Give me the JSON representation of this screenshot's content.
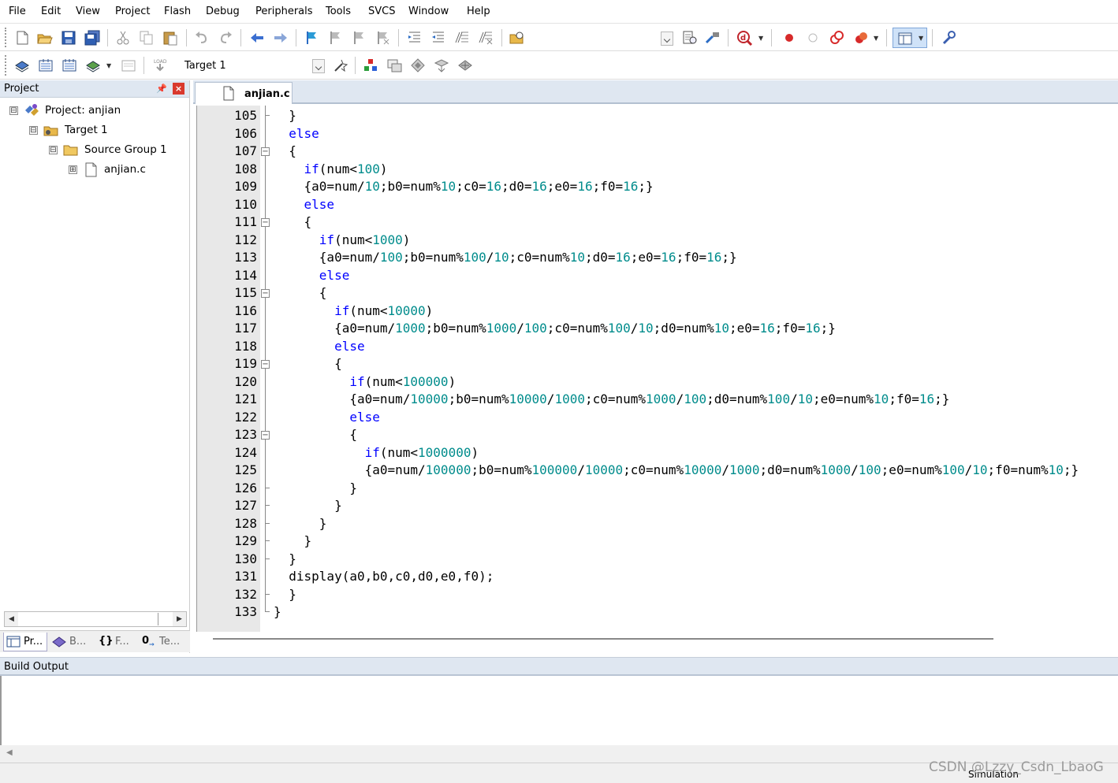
{
  "menu": [
    "File",
    "Edit",
    "View",
    "Project",
    "Flash",
    "Debug",
    "Peripherals",
    "Tools",
    "SVCS",
    "Window",
    "Help"
  ],
  "toolbar": {
    "target": "Target 1"
  },
  "project_panel": {
    "title": "Project",
    "tree": [
      {
        "label": "Project: anjian",
        "depth": 0,
        "expander": "⊟"
      },
      {
        "label": "Target 1",
        "depth": 1,
        "expander": "⊟"
      },
      {
        "label": "Source Group 1",
        "depth": 2,
        "expander": "⊟"
      },
      {
        "label": "anjian.c",
        "depth": 3,
        "expander": "⊞"
      }
    ],
    "tabs": [
      "Pr...",
      "B...",
      "F...",
      "Te..."
    ]
  },
  "editor": {
    "file_tab": "anjian.c",
    "lines": [
      {
        "n": "105",
        "text": "  }"
      },
      {
        "n": "106",
        "text": "  else"
      },
      {
        "n": "107",
        "text": "  {"
      },
      {
        "n": "108",
        "text": "    if(num<100)"
      },
      {
        "n": "109",
        "text": "    {a0=num/10;b0=num%10;c0=16;d0=16;e0=16;f0=16;}"
      },
      {
        "n": "110",
        "text": "    else"
      },
      {
        "n": "111",
        "text": "    {"
      },
      {
        "n": "112",
        "text": "      if(num<1000)"
      },
      {
        "n": "113",
        "text": "      {a0=num/100;b0=num%100/10;c0=num%10;d0=16;e0=16;f0=16;}"
      },
      {
        "n": "114",
        "text": "      else"
      },
      {
        "n": "115",
        "text": "      {"
      },
      {
        "n": "116",
        "text": "        if(num<10000)"
      },
      {
        "n": "117",
        "text": "        {a0=num/1000;b0=num%1000/100;c0=num%100/10;d0=num%10;e0=16;f0=16;}"
      },
      {
        "n": "118",
        "text": "        else"
      },
      {
        "n": "119",
        "text": "        {"
      },
      {
        "n": "120",
        "text": "          if(num<100000)"
      },
      {
        "n": "121",
        "text": "          {a0=num/10000;b0=num%10000/1000;c0=num%1000/100;d0=num%100/10;e0=num%10;f0=16;}"
      },
      {
        "n": "122",
        "text": "          else"
      },
      {
        "n": "123",
        "text": "          {"
      },
      {
        "n": "124",
        "text": "            if(num<1000000)"
      },
      {
        "n": "125",
        "text": "            {a0=num/100000;b0=num%100000/10000;c0=num%10000/1000;d0=num%1000/100;e0=num%100/10;f0=num%10;}"
      },
      {
        "n": "126",
        "text": "          }"
      },
      {
        "n": "127",
        "text": "        }"
      },
      {
        "n": "128",
        "text": "      }"
      },
      {
        "n": "129",
        "text": "    }"
      },
      {
        "n": "130",
        "text": "  }"
      },
      {
        "n": "131",
        "text": "  display(a0,b0,c0,d0,e0,f0);"
      },
      {
        "n": "132",
        "text": "  }"
      },
      {
        "n": "133",
        "text": "}"
      }
    ]
  },
  "build_output": {
    "title": "Build Output"
  },
  "status": {
    "mode": "Simulation"
  },
  "watermark": "CSDN @Lzzy_Csdn_LbaoG",
  "colors": {
    "keyword": "#0000ff",
    "number": "#008c8c",
    "panel_header": "#dfe7f1"
  }
}
